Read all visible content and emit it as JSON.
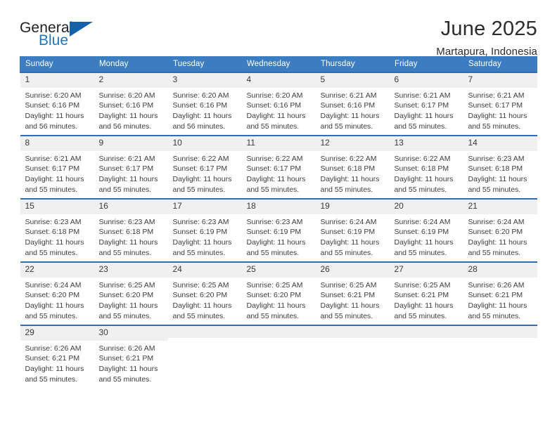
{
  "brand": {
    "name_top": "General",
    "name_bottom": "Blue",
    "color_blue": "#1f76bc",
    "color_dark": "#231f20"
  },
  "header": {
    "title": "June 2025",
    "subtitle": "Martapura, Indonesia",
    "header_bg": "#3b7dc0",
    "row_border": "#2f6eb5",
    "daynum_bg": "#f0f0f0"
  },
  "weekdays": [
    "Sunday",
    "Monday",
    "Tuesday",
    "Wednesday",
    "Thursday",
    "Friday",
    "Saturday"
  ],
  "labels": {
    "sunrise": "Sunrise:",
    "sunset": "Sunset:",
    "daylight": "Daylight:"
  },
  "weeks": [
    [
      {
        "day": "1",
        "sunrise": "Sunrise: 6:20 AM",
        "sunset": "Sunset: 6:16 PM",
        "daylight1": "Daylight: 11 hours",
        "daylight2": "and 56 minutes."
      },
      {
        "day": "2",
        "sunrise": "Sunrise: 6:20 AM",
        "sunset": "Sunset: 6:16 PM",
        "daylight1": "Daylight: 11 hours",
        "daylight2": "and 56 minutes."
      },
      {
        "day": "3",
        "sunrise": "Sunrise: 6:20 AM",
        "sunset": "Sunset: 6:16 PM",
        "daylight1": "Daylight: 11 hours",
        "daylight2": "and 56 minutes."
      },
      {
        "day": "4",
        "sunrise": "Sunrise: 6:20 AM",
        "sunset": "Sunset: 6:16 PM",
        "daylight1": "Daylight: 11 hours",
        "daylight2": "and 55 minutes."
      },
      {
        "day": "5",
        "sunrise": "Sunrise: 6:21 AM",
        "sunset": "Sunset: 6:16 PM",
        "daylight1": "Daylight: 11 hours",
        "daylight2": "and 55 minutes."
      },
      {
        "day": "6",
        "sunrise": "Sunrise: 6:21 AM",
        "sunset": "Sunset: 6:17 PM",
        "daylight1": "Daylight: 11 hours",
        "daylight2": "and 55 minutes."
      },
      {
        "day": "7",
        "sunrise": "Sunrise: 6:21 AM",
        "sunset": "Sunset: 6:17 PM",
        "daylight1": "Daylight: 11 hours",
        "daylight2": "and 55 minutes."
      }
    ],
    [
      {
        "day": "8",
        "sunrise": "Sunrise: 6:21 AM",
        "sunset": "Sunset: 6:17 PM",
        "daylight1": "Daylight: 11 hours",
        "daylight2": "and 55 minutes."
      },
      {
        "day": "9",
        "sunrise": "Sunrise: 6:21 AM",
        "sunset": "Sunset: 6:17 PM",
        "daylight1": "Daylight: 11 hours",
        "daylight2": "and 55 minutes."
      },
      {
        "day": "10",
        "sunrise": "Sunrise: 6:22 AM",
        "sunset": "Sunset: 6:17 PM",
        "daylight1": "Daylight: 11 hours",
        "daylight2": "and 55 minutes."
      },
      {
        "day": "11",
        "sunrise": "Sunrise: 6:22 AM",
        "sunset": "Sunset: 6:17 PM",
        "daylight1": "Daylight: 11 hours",
        "daylight2": "and 55 minutes."
      },
      {
        "day": "12",
        "sunrise": "Sunrise: 6:22 AM",
        "sunset": "Sunset: 6:18 PM",
        "daylight1": "Daylight: 11 hours",
        "daylight2": "and 55 minutes."
      },
      {
        "day": "13",
        "sunrise": "Sunrise: 6:22 AM",
        "sunset": "Sunset: 6:18 PM",
        "daylight1": "Daylight: 11 hours",
        "daylight2": "and 55 minutes."
      },
      {
        "day": "14",
        "sunrise": "Sunrise: 6:23 AM",
        "sunset": "Sunset: 6:18 PM",
        "daylight1": "Daylight: 11 hours",
        "daylight2": "and 55 minutes."
      }
    ],
    [
      {
        "day": "15",
        "sunrise": "Sunrise: 6:23 AM",
        "sunset": "Sunset: 6:18 PM",
        "daylight1": "Daylight: 11 hours",
        "daylight2": "and 55 minutes."
      },
      {
        "day": "16",
        "sunrise": "Sunrise: 6:23 AM",
        "sunset": "Sunset: 6:18 PM",
        "daylight1": "Daylight: 11 hours",
        "daylight2": "and 55 minutes."
      },
      {
        "day": "17",
        "sunrise": "Sunrise: 6:23 AM",
        "sunset": "Sunset: 6:19 PM",
        "daylight1": "Daylight: 11 hours",
        "daylight2": "and 55 minutes."
      },
      {
        "day": "18",
        "sunrise": "Sunrise: 6:23 AM",
        "sunset": "Sunset: 6:19 PM",
        "daylight1": "Daylight: 11 hours",
        "daylight2": "and 55 minutes."
      },
      {
        "day": "19",
        "sunrise": "Sunrise: 6:24 AM",
        "sunset": "Sunset: 6:19 PM",
        "daylight1": "Daylight: 11 hours",
        "daylight2": "and 55 minutes."
      },
      {
        "day": "20",
        "sunrise": "Sunrise: 6:24 AM",
        "sunset": "Sunset: 6:19 PM",
        "daylight1": "Daylight: 11 hours",
        "daylight2": "and 55 minutes."
      },
      {
        "day": "21",
        "sunrise": "Sunrise: 6:24 AM",
        "sunset": "Sunset: 6:20 PM",
        "daylight1": "Daylight: 11 hours",
        "daylight2": "and 55 minutes."
      }
    ],
    [
      {
        "day": "22",
        "sunrise": "Sunrise: 6:24 AM",
        "sunset": "Sunset: 6:20 PM",
        "daylight1": "Daylight: 11 hours",
        "daylight2": "and 55 minutes."
      },
      {
        "day": "23",
        "sunrise": "Sunrise: 6:25 AM",
        "sunset": "Sunset: 6:20 PM",
        "daylight1": "Daylight: 11 hours",
        "daylight2": "and 55 minutes."
      },
      {
        "day": "24",
        "sunrise": "Sunrise: 6:25 AM",
        "sunset": "Sunset: 6:20 PM",
        "daylight1": "Daylight: 11 hours",
        "daylight2": "and 55 minutes."
      },
      {
        "day": "25",
        "sunrise": "Sunrise: 6:25 AM",
        "sunset": "Sunset: 6:20 PM",
        "daylight1": "Daylight: 11 hours",
        "daylight2": "and 55 minutes."
      },
      {
        "day": "26",
        "sunrise": "Sunrise: 6:25 AM",
        "sunset": "Sunset: 6:21 PM",
        "daylight1": "Daylight: 11 hours",
        "daylight2": "and 55 minutes."
      },
      {
        "day": "27",
        "sunrise": "Sunrise: 6:25 AM",
        "sunset": "Sunset: 6:21 PM",
        "daylight1": "Daylight: 11 hours",
        "daylight2": "and 55 minutes."
      },
      {
        "day": "28",
        "sunrise": "Sunrise: 6:26 AM",
        "sunset": "Sunset: 6:21 PM",
        "daylight1": "Daylight: 11 hours",
        "daylight2": "and 55 minutes."
      }
    ],
    [
      {
        "day": "29",
        "sunrise": "Sunrise: 6:26 AM",
        "sunset": "Sunset: 6:21 PM",
        "daylight1": "Daylight: 11 hours",
        "daylight2": "and 55 minutes."
      },
      {
        "day": "30",
        "sunrise": "Sunrise: 6:26 AM",
        "sunset": "Sunset: 6:21 PM",
        "daylight1": "Daylight: 11 hours",
        "daylight2": "and 55 minutes."
      },
      {
        "day": "",
        "sunrise": "",
        "sunset": "",
        "daylight1": "",
        "daylight2": ""
      },
      {
        "day": "",
        "sunrise": "",
        "sunset": "",
        "daylight1": "",
        "daylight2": ""
      },
      {
        "day": "",
        "sunrise": "",
        "sunset": "",
        "daylight1": "",
        "daylight2": ""
      },
      {
        "day": "",
        "sunrise": "",
        "sunset": "",
        "daylight1": "",
        "daylight2": ""
      },
      {
        "day": "",
        "sunrise": "",
        "sunset": "",
        "daylight1": "",
        "daylight2": ""
      }
    ]
  ]
}
